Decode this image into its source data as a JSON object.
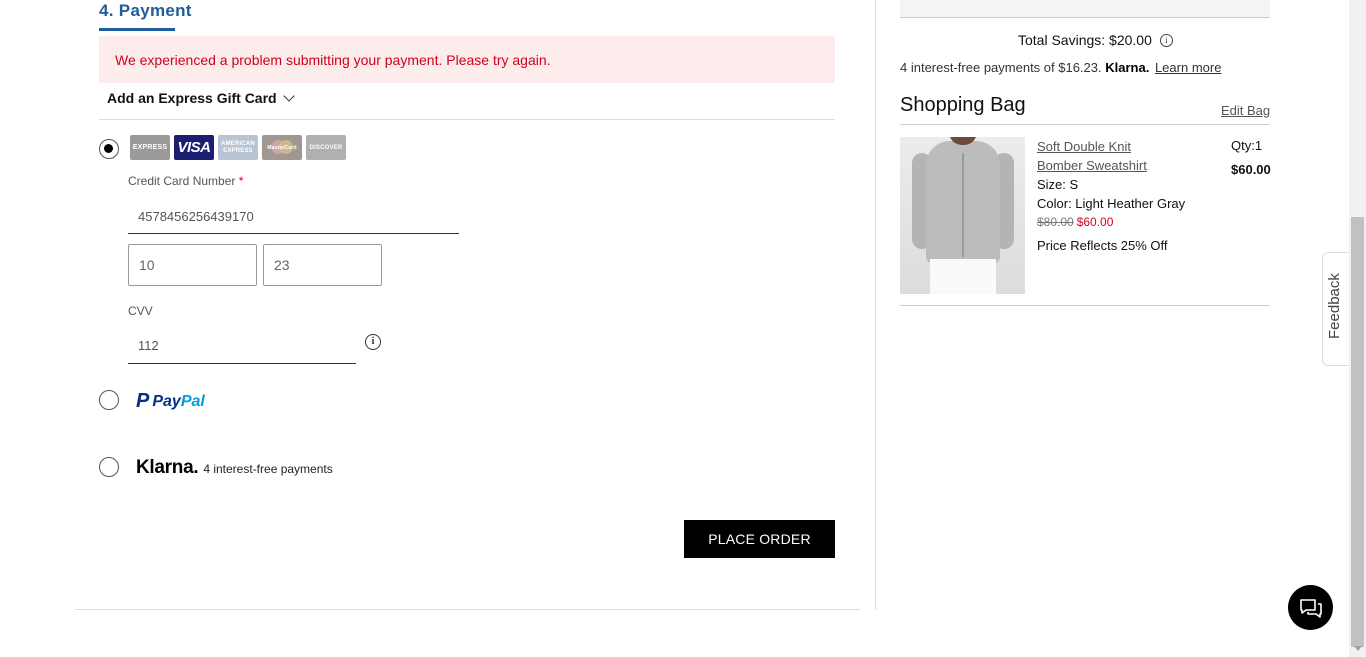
{
  "payment": {
    "step_title": "4. Payment",
    "error_message": "We experienced a problem submitting your payment. Please try again.",
    "gift_card_label": "Add an Express Gift Card",
    "card_brands": [
      "EXPRESS",
      "VISA",
      "AMERICAN EXPRESS",
      "MasterCard",
      "DISCOVER"
    ],
    "credit_card": {
      "number_label": "Credit Card Number",
      "required_mark": "*",
      "number_value": "4578456256439170",
      "month_value": "10",
      "year_value": "23",
      "cvv_label": "CVV",
      "cvv_value": "112",
      "selected": true
    },
    "paypal": {
      "logo_mark": "P",
      "logo_pay": "Pay",
      "logo_pal": "Pal",
      "selected": false
    },
    "klarna": {
      "logo": "Klarna.",
      "text": "4 interest-free payments",
      "selected": false
    },
    "place_order_label": "PLACE ORDER"
  },
  "summary": {
    "total_savings": "Total Savings: $20.00",
    "klarna_prefix": "4 interest-free payments of $16.23.",
    "klarna_brand": "Klarna.",
    "learn_more": "Learn more"
  },
  "bag": {
    "title": "Shopping Bag",
    "edit_label": "Edit Bag",
    "item": {
      "name_line1": "Soft Double Knit",
      "name_line2": "Bomber Sweatshirt",
      "size": "Size: S",
      "color": "Color: Light Heather Gray",
      "original_price": "$80.00",
      "sale_price": "$60.00",
      "reflects": "Price Reflects 25% Off",
      "qty": "Qty:1",
      "line_total": "$60.00"
    }
  },
  "feedback_label": "Feedback",
  "colors": {
    "accent_blue": "#1f5c9b",
    "error_red": "#d0021b",
    "error_bg": "#fcecec",
    "black": "#000000"
  },
  "icons": {
    "info": "info-icon",
    "chevron": "chevron-down-icon",
    "chat": "chat-icon"
  }
}
